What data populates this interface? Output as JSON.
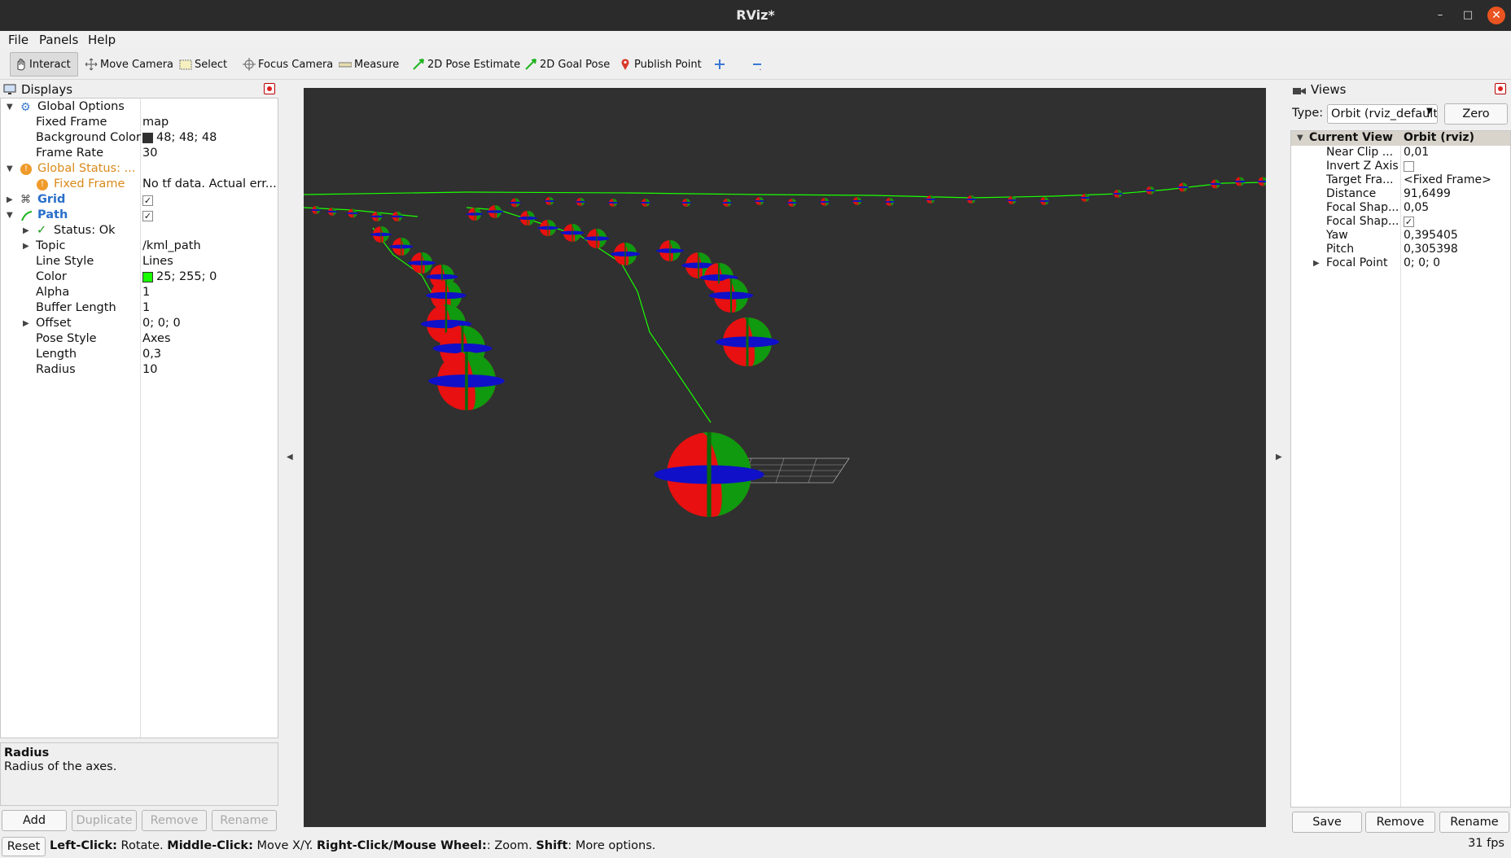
{
  "window": {
    "title": "RViz*"
  },
  "menu": {
    "file": "File",
    "panels": "Panels",
    "help": "Help"
  },
  "toolbar": {
    "interact": "Interact",
    "move_camera": "Move Camera",
    "select": "Select",
    "focus_camera": "Focus Camera",
    "measure": "Measure",
    "pose_estimate": "2D Pose Estimate",
    "goal_pose": "2D Goal Pose",
    "publish_point": "Publish Point"
  },
  "displays": {
    "title": "Displays",
    "rows": {
      "global_options": "Global Options",
      "fixed_frame": {
        "name": "Fixed Frame",
        "value": "map"
      },
      "background_color": {
        "name": "Background Color",
        "value": "48; 48; 48",
        "color": "#303030"
      },
      "frame_rate": {
        "name": "Frame Rate",
        "value": "30"
      },
      "global_status": "Global Status: ...",
      "fixed_frame_status": {
        "name": "Fixed Frame",
        "value": "No tf data.  Actual err..."
      },
      "grid": "Grid",
      "path": "Path",
      "status_ok": "Status: Ok",
      "topic": {
        "name": "Topic",
        "value": "/kml_path"
      },
      "line_style": {
        "name": "Line Style",
        "value": "Lines"
      },
      "color": {
        "name": "Color",
        "value": "25; 255; 0",
        "color": "#19ff00"
      },
      "alpha": {
        "name": "Alpha",
        "value": "1"
      },
      "buffer_length": {
        "name": "Buffer Length",
        "value": "1"
      },
      "offset": {
        "name": "Offset",
        "value": "0; 0; 0"
      },
      "pose_style": {
        "name": "Pose Style",
        "value": "Axes"
      },
      "length": {
        "name": "Length",
        "value": "0,3"
      },
      "radius": {
        "name": "Radius",
        "value": "10"
      }
    },
    "description": {
      "title": "Radius",
      "text": "Radius of the axes."
    },
    "buttons": {
      "add": "Add",
      "duplicate": "Duplicate",
      "remove": "Remove",
      "rename": "Rename"
    }
  },
  "views": {
    "title": "Views",
    "type_label": "Type:",
    "type_value": "Orbit (rviz_default_plugins)",
    "zero": "Zero",
    "header": {
      "name": "Current View",
      "value": "Orbit (rviz)"
    },
    "rows": {
      "near_clip": {
        "name": "Near Clip ...",
        "value": "0,01"
      },
      "invert_z": {
        "name": "Invert Z Axis"
      },
      "target_frame": {
        "name": "Target Fra...",
        "value": "<Fixed Frame>"
      },
      "distance": {
        "name": "Distance",
        "value": "91,6499"
      },
      "focal_size": {
        "name": "Focal Shap...",
        "value": "0,05"
      },
      "focal_enabled": {
        "name": "Focal Shap..."
      },
      "yaw": {
        "name": "Yaw",
        "value": "0,395405"
      },
      "pitch": {
        "name": "Pitch",
        "value": "0,305398"
      },
      "focal_point": {
        "name": "Focal Point",
        "value": "0; 0; 0"
      }
    },
    "buttons": {
      "save": "Save",
      "remove": "Remove",
      "rename": "Rename"
    }
  },
  "statusbar": {
    "reset": "Reset",
    "h1": "Left-Click:",
    "t1": " Rotate. ",
    "h2": "Middle-Click:",
    "t2": " Move X/Y. ",
    "h3": "Right-Click/Mouse Wheel:",
    "t3": ": Zoom. ",
    "h4": "Shift",
    "t4": ": More options.",
    "fps": "31 fps"
  }
}
